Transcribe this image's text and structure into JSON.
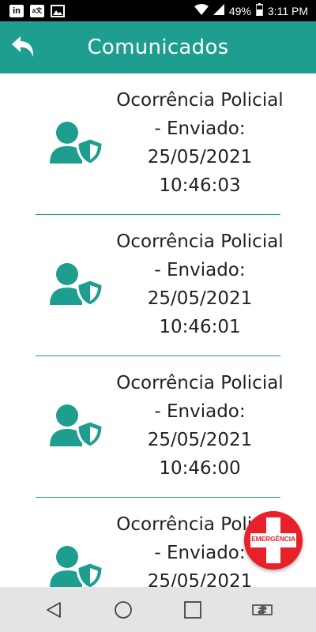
{
  "status_bar": {
    "linkedin_icon": "linkedin-icon",
    "translate_icon": "translate-icon",
    "image_icon": "image-icon",
    "battery_text": "49%",
    "time": "3:11 PM"
  },
  "app_bar": {
    "back_icon": "undo-back-icon",
    "title": "Comunicados",
    "color": "#1e9e8e"
  },
  "notices": [
    {
      "line1": "Ocorrência Policial",
      "line2": "- Enviado:",
      "line3": "25/05/2021",
      "line4": "10:46:03"
    },
    {
      "line1": "Ocorrência Policial",
      "line2": "- Enviado:",
      "line3": "25/05/2021",
      "line4": "10:46:01"
    },
    {
      "line1": "Ocorrência Policial",
      "line2": "- Enviado:",
      "line3": "25/05/2021",
      "line4": "10:46:00"
    },
    {
      "line1": "Ocorrência Policial",
      "line2": "- Enviado:",
      "line3": "25/05/2021",
      "line4": ""
    }
  ],
  "emergency_button": {
    "label": "EMERGÊNCIA",
    "color": "#e8202a"
  },
  "nav_bar": {
    "back": "back-triangle-icon",
    "home": "home-circle-icon",
    "recents": "recents-square-icon",
    "switch": "switch-app-icon"
  }
}
